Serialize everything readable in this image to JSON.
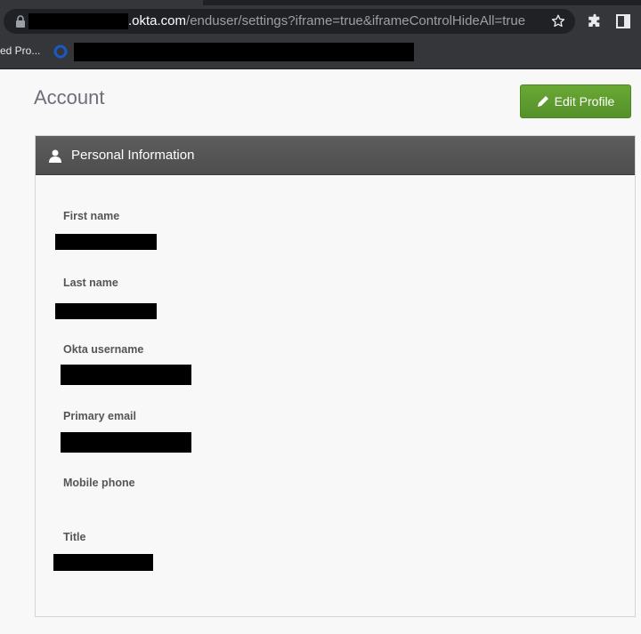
{
  "browser": {
    "url_host": ".okta.com",
    "url_path": "/enduser/settings?iframe=true&iframeControlHideAll=true",
    "bookmark_label": "ed Pro..."
  },
  "icons": {
    "lock": "lock-icon",
    "star": "star-icon",
    "extensions": "puzzle-icon",
    "side_panel": "side-panel-icon",
    "edit": "pencil-icon",
    "user": "user-icon"
  },
  "colors": {
    "accent_green": "#5f9c2e",
    "panel_header": "#555555"
  },
  "page": {
    "title": "Account",
    "edit_button_label": "Edit Profile"
  },
  "personal_info": {
    "header": "Personal Information",
    "fields": [
      {
        "label": "First name"
      },
      {
        "label": "Last name"
      },
      {
        "label": "Okta username"
      },
      {
        "label": "Primary email"
      },
      {
        "label": "Mobile phone"
      },
      {
        "label": "Title"
      }
    ]
  }
}
